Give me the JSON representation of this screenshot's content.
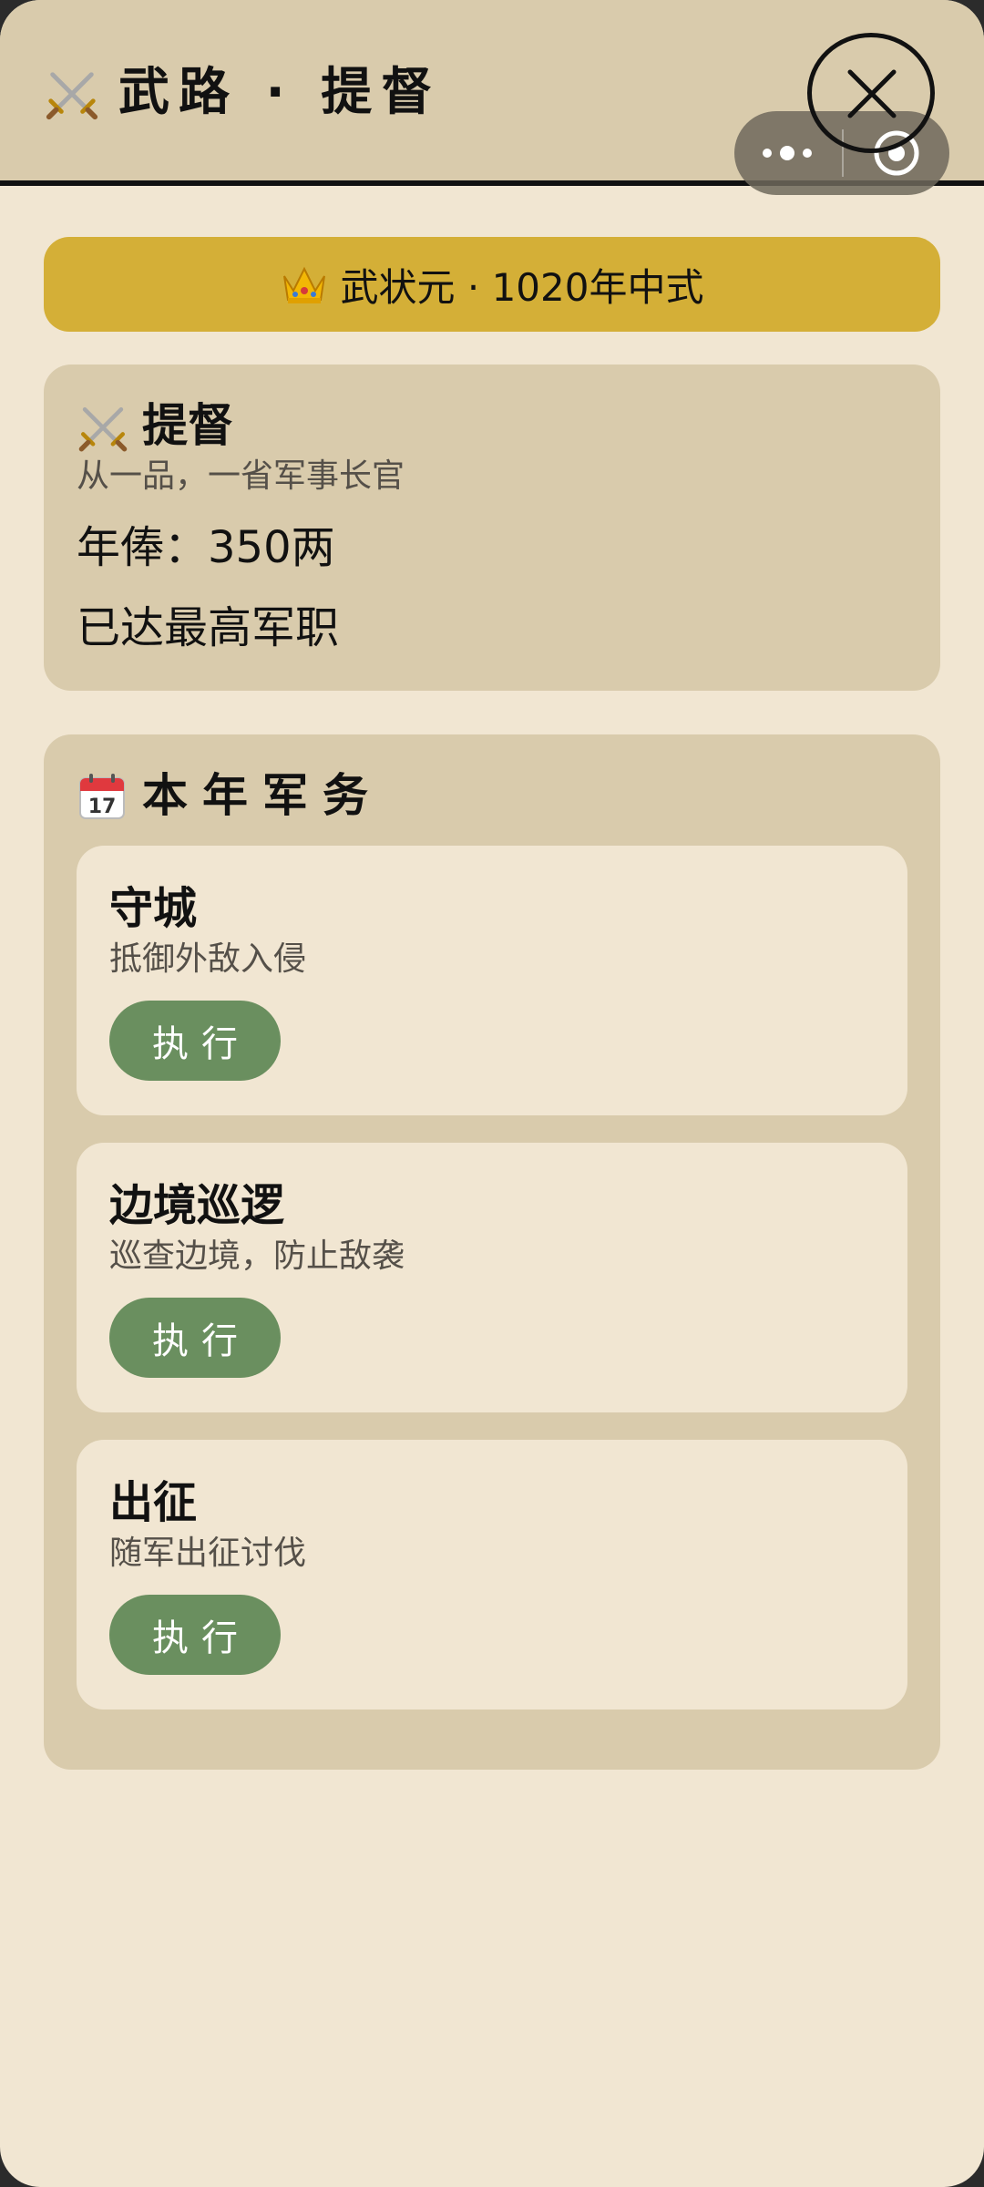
{
  "header": {
    "title": "武路 · 提督",
    "icon": "crossed-swords-icon"
  },
  "capsule": {
    "more_icon": "more-dots-icon",
    "record_icon": "record-target-icon",
    "close_icon": "close-icon"
  },
  "banner": {
    "icon": "crown-icon",
    "text": "武状元 · 1020年中式",
    "color": "#d4af37"
  },
  "rank": {
    "icon": "crossed-swords-icon",
    "title": "提督",
    "description": "从一品，一省军事长官",
    "salary": "年俸：350两",
    "status": "已达最高军职"
  },
  "duties": {
    "icon": "calendar-icon",
    "title": "本年军务",
    "items": [
      {
        "name": "守城",
        "description": "抵御外敌入侵",
        "button_label": "执行"
      },
      {
        "name": "边境巡逻",
        "description": "巡查边境，防止敌袭",
        "button_label": "执行"
      },
      {
        "name": "出征",
        "description": "随军出征讨伐",
        "button_label": "执行"
      }
    ]
  },
  "colors": {
    "background": "#f1e6d2",
    "panel": "#d9cbac",
    "accent_gold": "#d4af37",
    "button_green": "#6a8f5f"
  }
}
